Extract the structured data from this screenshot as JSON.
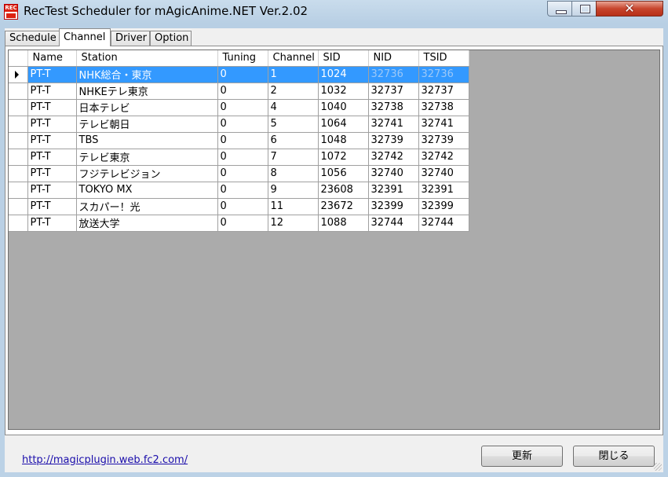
{
  "window": {
    "title": "RecTest Scheduler for mAgicAnime.NET  Ver.2.02",
    "app_icon_text": "REC",
    "close_glyph": "✕"
  },
  "tabs": [
    {
      "label": "Schedule",
      "active": false
    },
    {
      "label": "Channel",
      "active": true
    },
    {
      "label": "Driver",
      "active": false
    },
    {
      "label": "Option",
      "active": false
    }
  ],
  "grid": {
    "columns": [
      "Name",
      "Station",
      "Tuning",
      "Channel",
      "SID",
      "NID",
      "TSID"
    ],
    "selected_row": 0,
    "rows": [
      [
        "PT-T",
        "NHK総合・東京",
        "0",
        "1",
        "1024",
        "32736",
        "32736"
      ],
      [
        "PT-T",
        "NHKEテレ東京",
        "0",
        "2",
        "1032",
        "32737",
        "32737"
      ],
      [
        "PT-T",
        "日本テレビ",
        "0",
        "4",
        "1040",
        "32738",
        "32738"
      ],
      [
        "PT-T",
        "テレビ朝日",
        "0",
        "5",
        "1064",
        "32741",
        "32741"
      ],
      [
        "PT-T",
        "TBS",
        "0",
        "6",
        "1048",
        "32739",
        "32739"
      ],
      [
        "PT-T",
        "テレビ東京",
        "0",
        "7",
        "1072",
        "32742",
        "32742"
      ],
      [
        "PT-T",
        "フジテレビジョン",
        "0",
        "8",
        "1056",
        "32740",
        "32740"
      ],
      [
        "PT-T",
        "TOKYO  MX",
        "0",
        "9",
        "23608",
        "32391",
        "32391"
      ],
      [
        "PT-T",
        "スカパー！光",
        "0",
        "11",
        "23672",
        "32399",
        "32399"
      ],
      [
        "PT-T",
        "放送大学",
        "0",
        "12",
        "1088",
        "32744",
        "32744"
      ]
    ]
  },
  "footer": {
    "link": "http://magicplugin.web.fc2.com/",
    "update_button": "更新",
    "close_button": "閉じる"
  },
  "colors": {
    "selection": "#3399ff",
    "grid_background": "#ababab",
    "close_button": "#c7452d"
  }
}
